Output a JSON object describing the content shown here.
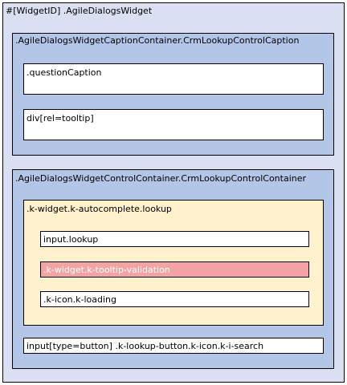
{
  "colors": {
    "outer_fill": "#dae0f2",
    "container_fill": "#b4c6e7",
    "field_fill": "#ffffff",
    "autocomplete_fill": "#fff2cc",
    "validation_fill": "#f4a3a3",
    "validation_text": "#ffffff",
    "border": "#000000"
  },
  "widget": {
    "label": "#[WidgetID] .AgileDialogsWidget",
    "caption_container": {
      "label": ".AgileDialogsWidgetCaptionContainer.CrmLookupControlCaption",
      "question_caption": ".questionCaption",
      "tooltip": "div[rel=tooltip]"
    },
    "control_container": {
      "label": ".AgileDialogsWidgetControlContainer.CrmLookupControlContainer",
      "autocomplete": {
        "label": ".k-widget.k-autocomplete.lookup",
        "input_lookup": "input.lookup",
        "tooltip_validation": ".k-widget.k-tooltip-validation",
        "loading_icon": ".k-icon.k-loading"
      },
      "search_button": "input[type=button] .k-lookup-button.k-icon.k-i-search"
    }
  }
}
